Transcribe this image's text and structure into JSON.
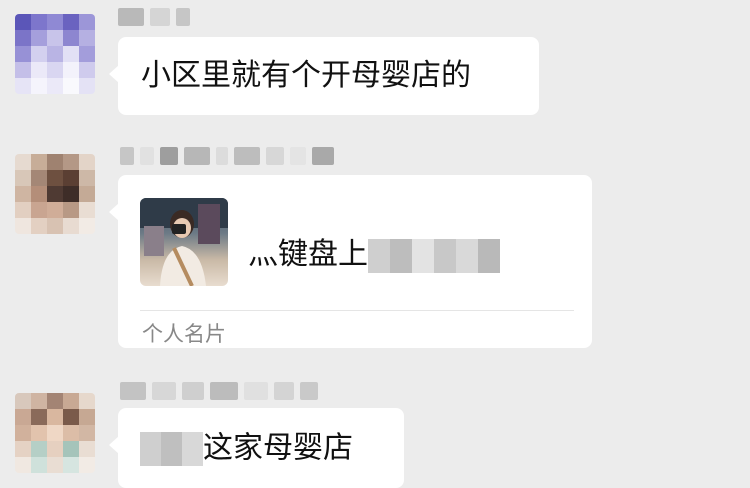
{
  "chat": {
    "messages": [
      {
        "text": "小区里就有个开母婴店的"
      },
      {
        "card_name": "灬键盘上",
        "card_label": "个人名片"
      },
      {
        "text": "这家母婴店"
      }
    ]
  }
}
